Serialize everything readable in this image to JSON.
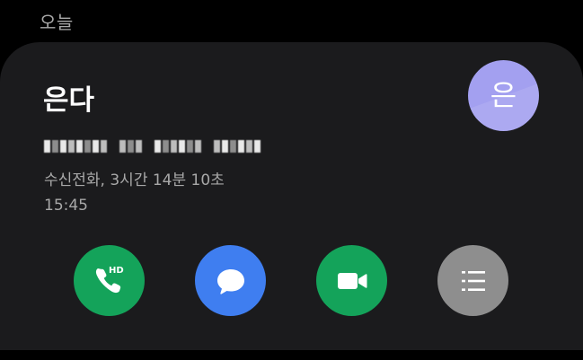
{
  "section": {
    "header": "오늘"
  },
  "contact": {
    "name": "은다",
    "avatar_initial": "은",
    "avatar_color": "#a3a0f0",
    "phone_number_redacted": true
  },
  "call": {
    "detail": "수신전화, 3시간 14분 10초",
    "time": "15:45"
  },
  "actions": [
    {
      "name": "HD voice call",
      "icon": "phone-hd-icon",
      "color": "#14a35a",
      "badge": "HD"
    },
    {
      "name": "Message",
      "icon": "message-bubble-icon",
      "color": "#3f7ef0"
    },
    {
      "name": "Video call",
      "icon": "video-camera-icon",
      "color": "#14a35a"
    },
    {
      "name": "Details",
      "icon": "list-icon",
      "color": "#8e8e8e"
    }
  ]
}
